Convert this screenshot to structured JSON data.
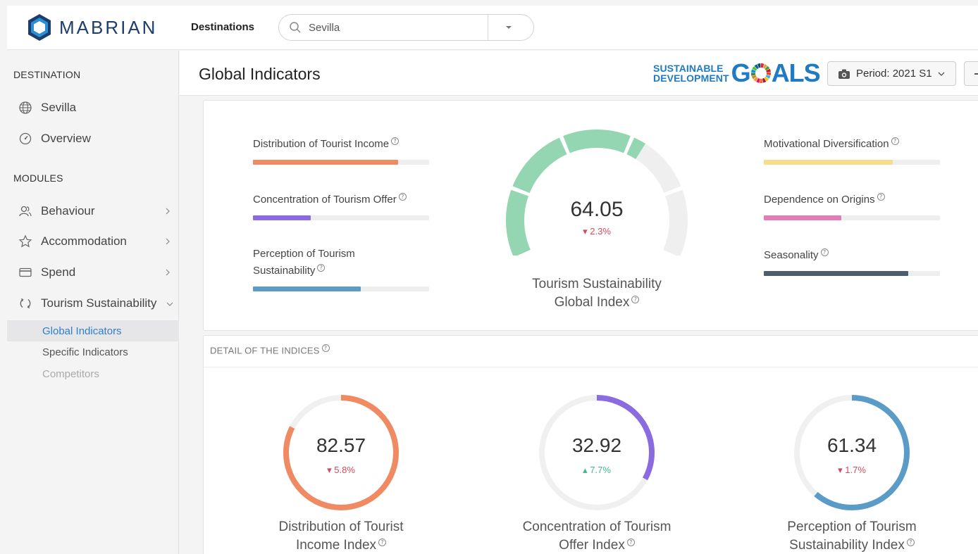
{
  "brand": {
    "name": "MABRIAN"
  },
  "topnav": {
    "destinations_label": "Destinations",
    "search": {
      "value": "Sevilla",
      "placeholder": "Sevilla"
    }
  },
  "sidebar": {
    "destination_title": "DESTINATION",
    "destination_items": [
      {
        "label": "Sevilla",
        "icon": "globe-icon"
      },
      {
        "label": "Overview",
        "icon": "gauge-icon"
      }
    ],
    "modules_title": "MODULES",
    "modules": [
      {
        "label": "Behaviour",
        "icon": "people-icon"
      },
      {
        "label": "Accommodation",
        "icon": "star-icon"
      },
      {
        "label": "Spend",
        "icon": "card-icon"
      },
      {
        "label": "Tourism Sustainability",
        "icon": "cycle-icon"
      }
    ],
    "sub_items": [
      {
        "label": "Global Indicators",
        "active": true
      },
      {
        "label": "Specific Indicators"
      },
      {
        "label": "Competitors",
        "disabled": true
      }
    ]
  },
  "header": {
    "title": "Global Indicators",
    "sdg": {
      "line1": "SUSTAINABLE",
      "line2": "DEVELOPMENT",
      "big_pre": "G",
      "big_post": "ALS"
    },
    "period_label": "Period: 2021 S1"
  },
  "global": {
    "left_indicators": [
      {
        "label": "Distribution of Tourist Income",
        "value": 82.57,
        "color": "#f08a63"
      },
      {
        "label": "Concentration of Tourism Offer",
        "value": 32.92,
        "color": "#8b6ce0"
      },
      {
        "label": "Perception of Tourism Sustainability",
        "value": 61.34,
        "color": "#5b9bc8"
      }
    ],
    "right_indicators": [
      {
        "label": "Motivational Diversification",
        "value": 73,
        "color": "#f7dc8b"
      },
      {
        "label": "Dependence on Origins",
        "value": 44,
        "color": "#e07fb7"
      },
      {
        "label": "Seasonality",
        "value": 82,
        "color": "#4d5d70"
      }
    ],
    "gauge": {
      "value": "64.05",
      "value_num": 64.05,
      "change": "2.3%",
      "direction": "down",
      "label_line1": "Tourism Sustainability",
      "label_line2": "Global Index",
      "fill_color": "#94d6b1",
      "track_color": "#efefef"
    }
  },
  "detail": {
    "title": "DETAIL OF THE INDICES",
    "indices": [
      {
        "value": "82.57",
        "value_num": 82.57,
        "change": "5.8%",
        "direction": "down",
        "label_line1": "Distribution of Tourist",
        "label_line2": "Income Index",
        "color": "#f08a63"
      },
      {
        "value": "32.92",
        "value_num": 32.92,
        "change": "7.7%",
        "direction": "up",
        "label_line1": "Concentration of Tourism",
        "label_line2": "Offer Index",
        "color": "#8b6ce0"
      },
      {
        "value": "61.34",
        "value_num": 61.34,
        "change": "1.7%",
        "direction": "down",
        "label_line1": "Perception of Tourism",
        "label_line2": "Sustainability Index",
        "color": "#5b9bc8"
      }
    ]
  }
}
